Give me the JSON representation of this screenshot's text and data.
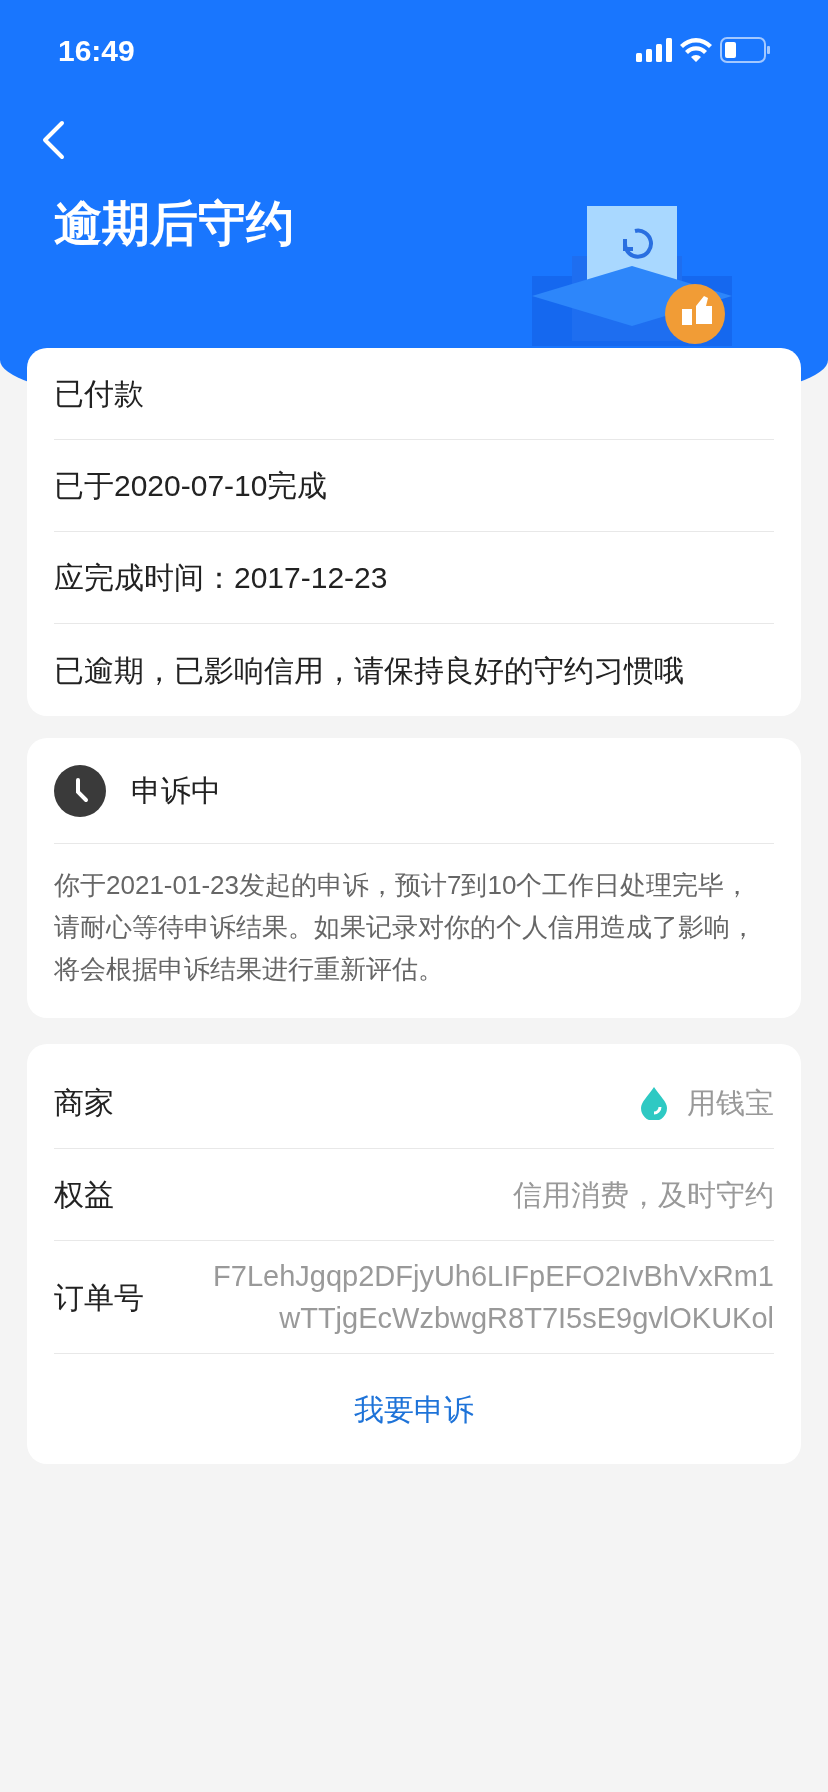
{
  "status_bar": {
    "time": "16:49"
  },
  "header": {
    "title": "逾期后守约"
  },
  "status_card": {
    "rows": [
      "已付款",
      "已于2020-07-10完成",
      "应完成时间：2017-12-23",
      "已逾期，已影响信用，请保持良好的守约习惯哦"
    ]
  },
  "appeal_card": {
    "title": "申诉中",
    "message": "你于2021-01-23发起的申诉，预计7到10个工作日处理完毕，请耐心等待申诉结果。如果记录对你的个人信用造成了影响，将会根据申诉结果进行重新评估。"
  },
  "detail_card": {
    "rows": [
      {
        "kind": "merchant",
        "label": "商家",
        "value": "用钱宝"
      },
      {
        "kind": "text",
        "label": "权益",
        "value": "信用消费，及时守约"
      },
      {
        "kind": "text",
        "label": "订单号",
        "value": "F7LehJgqp2DFjyUh6LIFpEFO2IvBhVxRm1wTTjgEcWzbwgR8T7I5sE9gvlOKUKol"
      }
    ],
    "action": "我要申诉"
  }
}
